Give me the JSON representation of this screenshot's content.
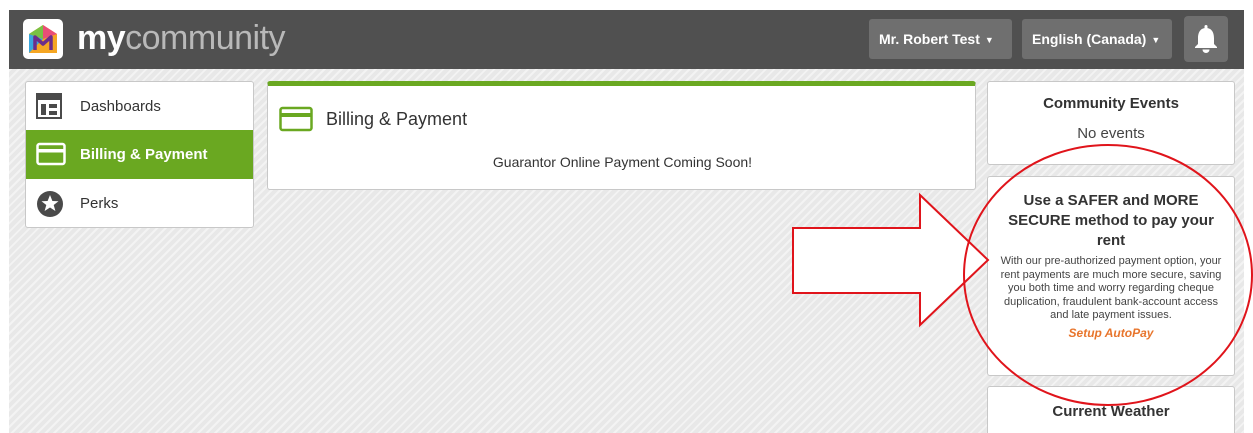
{
  "header": {
    "brand_my": "my",
    "brand_rest": "community",
    "user_menu": "Mr. Robert Test",
    "language_menu": "English (Canada)"
  },
  "sidebar": {
    "items": [
      {
        "label": "Dashboards",
        "icon": "dashboard-icon",
        "active": false
      },
      {
        "label": "Billing & Payment",
        "icon": "credit-card-icon",
        "active": true
      },
      {
        "label": "Perks",
        "icon": "star-icon",
        "active": false
      }
    ]
  },
  "main": {
    "title": "Billing & Payment",
    "message": "Guarantor Online Payment Coming Soon!"
  },
  "right": {
    "events": {
      "title": "Community Events",
      "text": "No events"
    },
    "promo": {
      "heading": "Use a SAFER and MORE SECURE method to pay your rent",
      "body": "With our pre-authorized payment option, your rent payments are much more secure, saving you both time and worry regarding cheque duplication, fraudulent bank-account access and late payment issues.",
      "link": "Setup AutoPay"
    },
    "weather": {
      "title": "Current Weather"
    }
  },
  "colors": {
    "accent_green": "#6aa821",
    "header_bg": "#505050",
    "link_orange": "#e8752c",
    "annotation_red": "#e0141b"
  }
}
